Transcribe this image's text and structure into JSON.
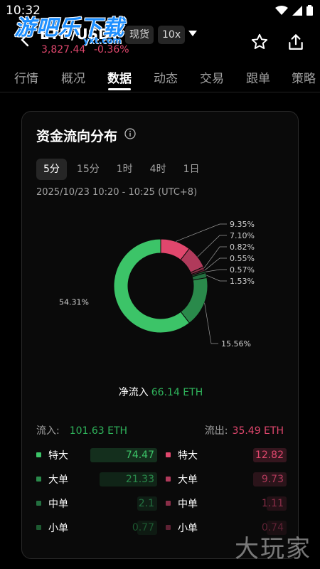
{
  "status": {
    "time": "10:32"
  },
  "watermark": {
    "top": "游吧乐下载",
    "top_sub": "yxt.com",
    "bottom": "大玩家"
  },
  "header": {
    "pair": "ETH/USDT",
    "price": "3,827.44",
    "change": "-0.36%",
    "tag_spot": "现货",
    "tag_leverage": "10x"
  },
  "tabs": [
    {
      "label": "行情"
    },
    {
      "label": "概况"
    },
    {
      "label": "数据"
    },
    {
      "label": "动态"
    },
    {
      "label": "交易"
    },
    {
      "label": "跟单"
    },
    {
      "label": "策略"
    }
  ],
  "card": {
    "title": "资金流向分布",
    "timeframes": [
      {
        "label": "5分",
        "active": true
      },
      {
        "label": "15分",
        "active": false
      },
      {
        "label": "1时",
        "active": false
      },
      {
        "label": "4时",
        "active": false
      },
      {
        "label": "1日",
        "active": false
      }
    ],
    "range": "2025/10/23 10:20 - 10:25 (UTC+8)",
    "net_label": "净流入",
    "net_value": "66.14 ETH",
    "inflow_label": "流入:",
    "inflow_value": "101.63 ETH",
    "outflow_label": "流出:",
    "outflow_value": "35.49 ETH"
  },
  "chart_data": {
    "type": "pie",
    "slices": [
      {
        "label": "特大 流出",
        "value": 9.35,
        "display": "9.35%",
        "color": "#e0476d"
      },
      {
        "label": "大单 流出",
        "value": 7.1,
        "display": "7.10%",
        "color": "#b03a5b"
      },
      {
        "label": "中单 流出",
        "value": 0.82,
        "display": "0.82%",
        "color": "#8a2e48"
      },
      {
        "label": "小单 流出",
        "value": 0.55,
        "display": "0.55%",
        "color": "#5e2234"
      },
      {
        "label": "小单 流入",
        "value": 0.57,
        "display": "0.57%",
        "color": "#1d5a31"
      },
      {
        "label": "中单 流入",
        "value": 1.53,
        "display": "1.53%",
        "color": "#237040"
      },
      {
        "label": "大单 流入",
        "value": 15.56,
        "display": "15.56%",
        "color": "#2a8a4b"
      },
      {
        "label": "特大 流入",
        "value": 54.31,
        "display": "54.31%",
        "color": "#3cc468"
      }
    ]
  },
  "sizes": {
    "inflow": [
      {
        "label": "特大",
        "value": "74.47",
        "fill": 1.0,
        "color": "#3cc468"
      },
      {
        "label": "大单",
        "value": "21.33",
        "fill": 0.86,
        "color": "#2a8a4b"
      },
      {
        "label": "中单",
        "value": "2.1",
        "fill": 0.3,
        "color": "#237040"
      },
      {
        "label": "小单",
        "value": "0.77",
        "fill": 0.3,
        "color": "#1d5a31"
      }
    ],
    "outflow": [
      {
        "label": "特大",
        "value": "12.82",
        "fill": 0.5,
        "color": "#e0476d"
      },
      {
        "label": "大单",
        "value": "9.73",
        "fill": 0.5,
        "color": "#b03a5b"
      },
      {
        "label": "中单",
        "value": "1.11",
        "fill": 0.3,
        "color": "#8a2e48"
      },
      {
        "label": "小单",
        "value": "0.74",
        "fill": 0.3,
        "color": "#5e2234"
      }
    ]
  }
}
